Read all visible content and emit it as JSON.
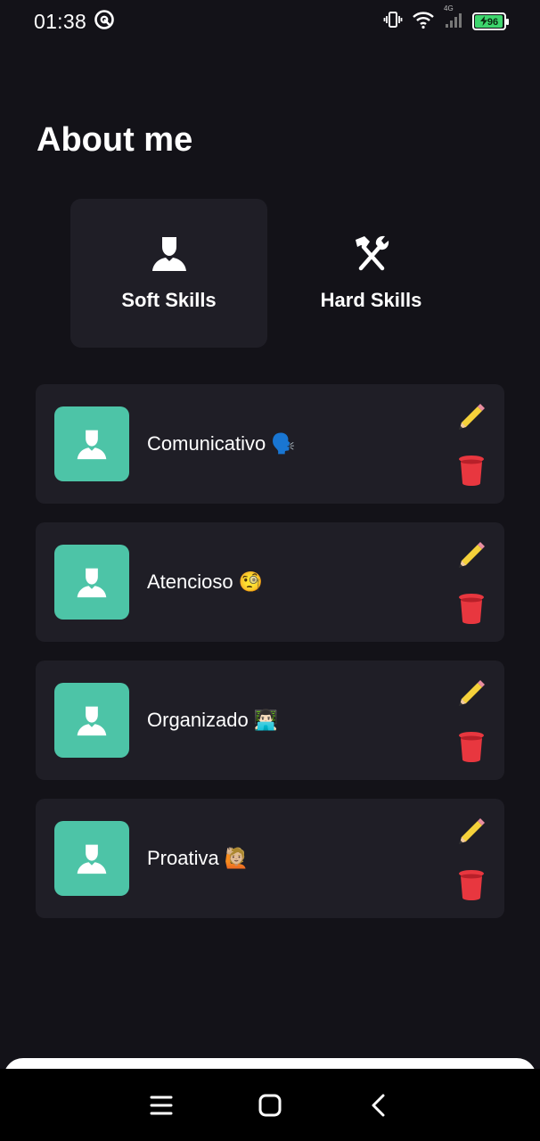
{
  "status_bar": {
    "time": "01:38",
    "battery": "96",
    "network": "4G",
    "battery_level": 0.96
  },
  "header": {
    "title": "About me"
  },
  "tabs": [
    {
      "label": "Soft Skills",
      "icon": "person-icon",
      "active": true
    },
    {
      "label": "Hard Skills",
      "icon": "hammer-wrench-icon",
      "active": false
    }
  ],
  "skills": [
    {
      "label": "Comunicativo",
      "emoji": "🗣️"
    },
    {
      "label": "Atencioso",
      "emoji": "🧐"
    },
    {
      "label": "Organizado",
      "emoji": "👨🏻‍💻"
    },
    {
      "label": "Proativa",
      "emoji": "🙋🏼"
    }
  ],
  "colors": {
    "background": "#131218",
    "card": "#1f1e26",
    "avatar": "#4dc4a7",
    "edit": "#f5d13a",
    "delete": "#e8373f",
    "battery": "#3dd56d"
  }
}
